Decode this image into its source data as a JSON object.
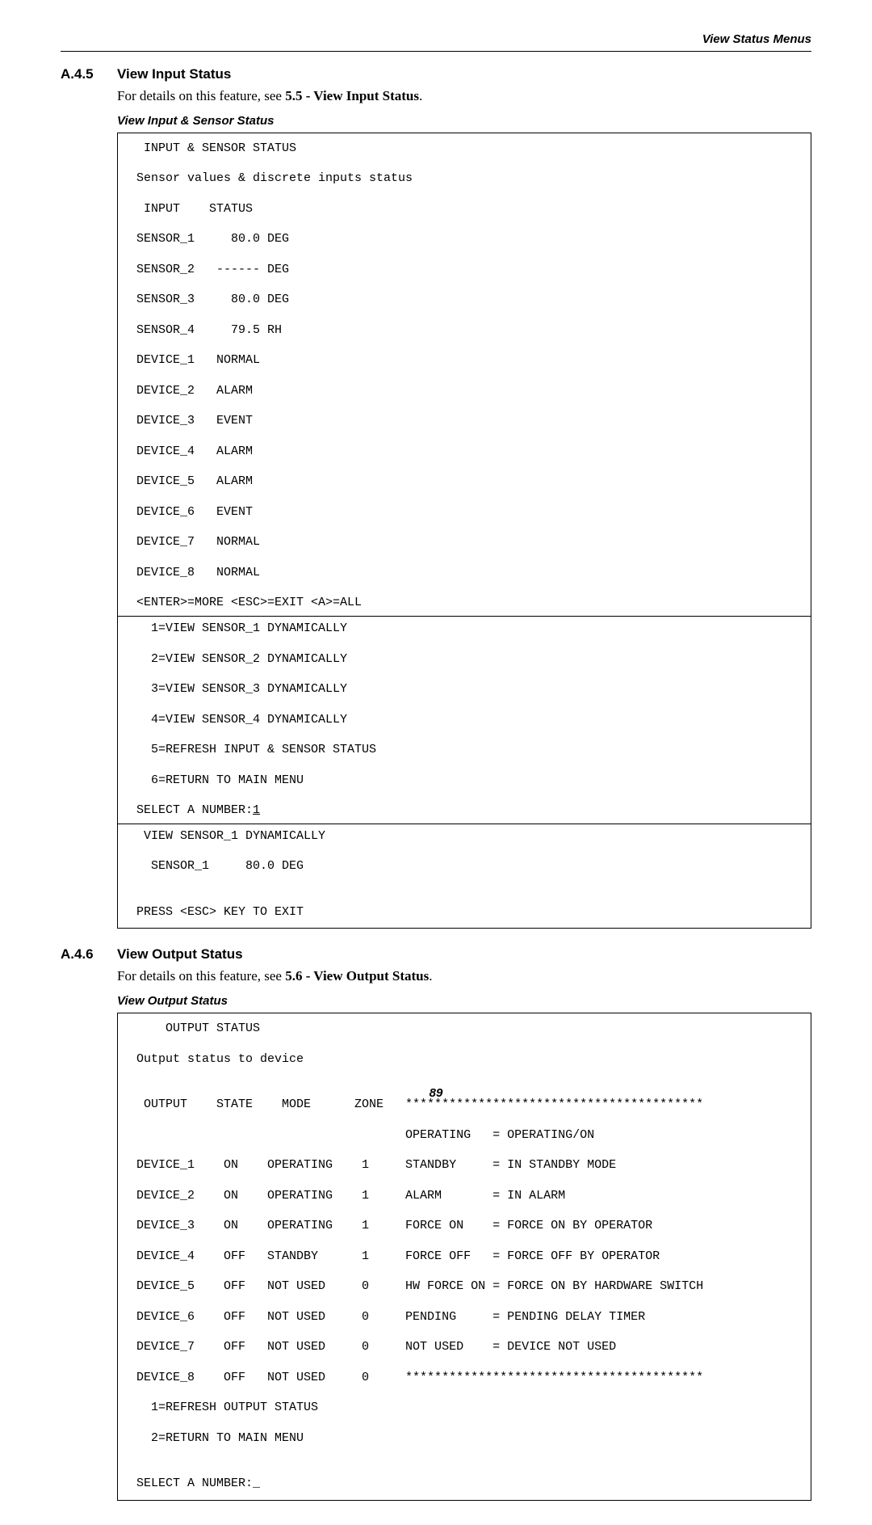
{
  "header": {
    "right": "View Status Menus"
  },
  "sec_a45": {
    "num": "A.4.5",
    "title": "View Input Status",
    "body_pre": "For details on this feature, see ",
    "body_xref": "5.5 - View Input Status",
    "body_post": "."
  },
  "block1": {
    "caption": "View Input & Sensor Status",
    "p1_title": "  INPUT & SENSOR STATUS",
    "p1_desc": " Sensor values & discrete inputs status",
    "p1_colhdr": "  INPUT    STATUS",
    "p1_rows": [
      " SENSOR_1     80.0 DEG",
      " SENSOR_2   ------ DEG",
      " SENSOR_3     80.0 DEG",
      " SENSOR_4     79.5 RH",
      " DEVICE_1   NORMAL",
      " DEVICE_2   ALARM",
      " DEVICE_3   EVENT",
      " DEVICE_4   ALARM",
      " DEVICE_5   ALARM",
      " DEVICE_6   EVENT",
      " DEVICE_7   NORMAL",
      " DEVICE_8   NORMAL"
    ],
    "p1_footer": " <ENTER>=MORE <ESC>=EXIT <A>=ALL",
    "p2_menu": [
      "   1=VIEW SENSOR_1 DYNAMICALLY",
      "   2=VIEW SENSOR_2 DYNAMICALLY",
      "   3=VIEW SENSOR_3 DYNAMICALLY",
      "   4=VIEW SENSOR_4 DYNAMICALLY",
      "   5=REFRESH INPUT & SENSOR STATUS",
      "   6=RETURN TO MAIN MENU"
    ],
    "p2_prompt_label": " SELECT A NUMBER:",
    "p2_prompt_value": "1",
    "p3_title": "  VIEW SENSOR_1 DYNAMICALLY",
    "p3_value": "   SENSOR_1     80.0 DEG",
    "p3_footer": " PRESS <ESC> KEY TO EXIT"
  },
  "sec_a46": {
    "num": "A.4.6",
    "title": "View Output Status",
    "body_pre": "For details on this feature, see ",
    "body_xref": "5.6 - View Output Status",
    "body_post": "."
  },
  "block2": {
    "caption": "View Output Status",
    "title": "     OUTPUT STATUS",
    "desc": " Output status to device",
    "rows": [
      "  OUTPUT    STATE    MODE      ZONE   *****************************************",
      "                                      OPERATING   = OPERATING/ON",
      " DEVICE_1    ON    OPERATING    1     STANDBY     = IN STANDBY MODE",
      " DEVICE_2    ON    OPERATING    1     ALARM       = IN ALARM",
      " DEVICE_3    ON    OPERATING    1     FORCE ON    = FORCE ON BY OPERATOR",
      " DEVICE_4    OFF   STANDBY      1     FORCE OFF   = FORCE OFF BY OPERATOR",
      " DEVICE_5    OFF   NOT USED     0     HW FORCE ON = FORCE ON BY HARDWARE SWITCH",
      " DEVICE_6    OFF   NOT USED     0     PENDING     = PENDING DELAY TIMER",
      " DEVICE_7    OFF   NOT USED     0     NOT USED    = DEVICE NOT USED",
      " DEVICE_8    OFF   NOT USED     0     *****************************************"
    ],
    "menu": [
      "   1=REFRESH OUTPUT STATUS",
      "   2=RETURN TO MAIN MENU"
    ],
    "prompt_label": " SELECT A NUMBER:",
    "prompt_value": "_"
  },
  "footer": {
    "page": "89"
  }
}
